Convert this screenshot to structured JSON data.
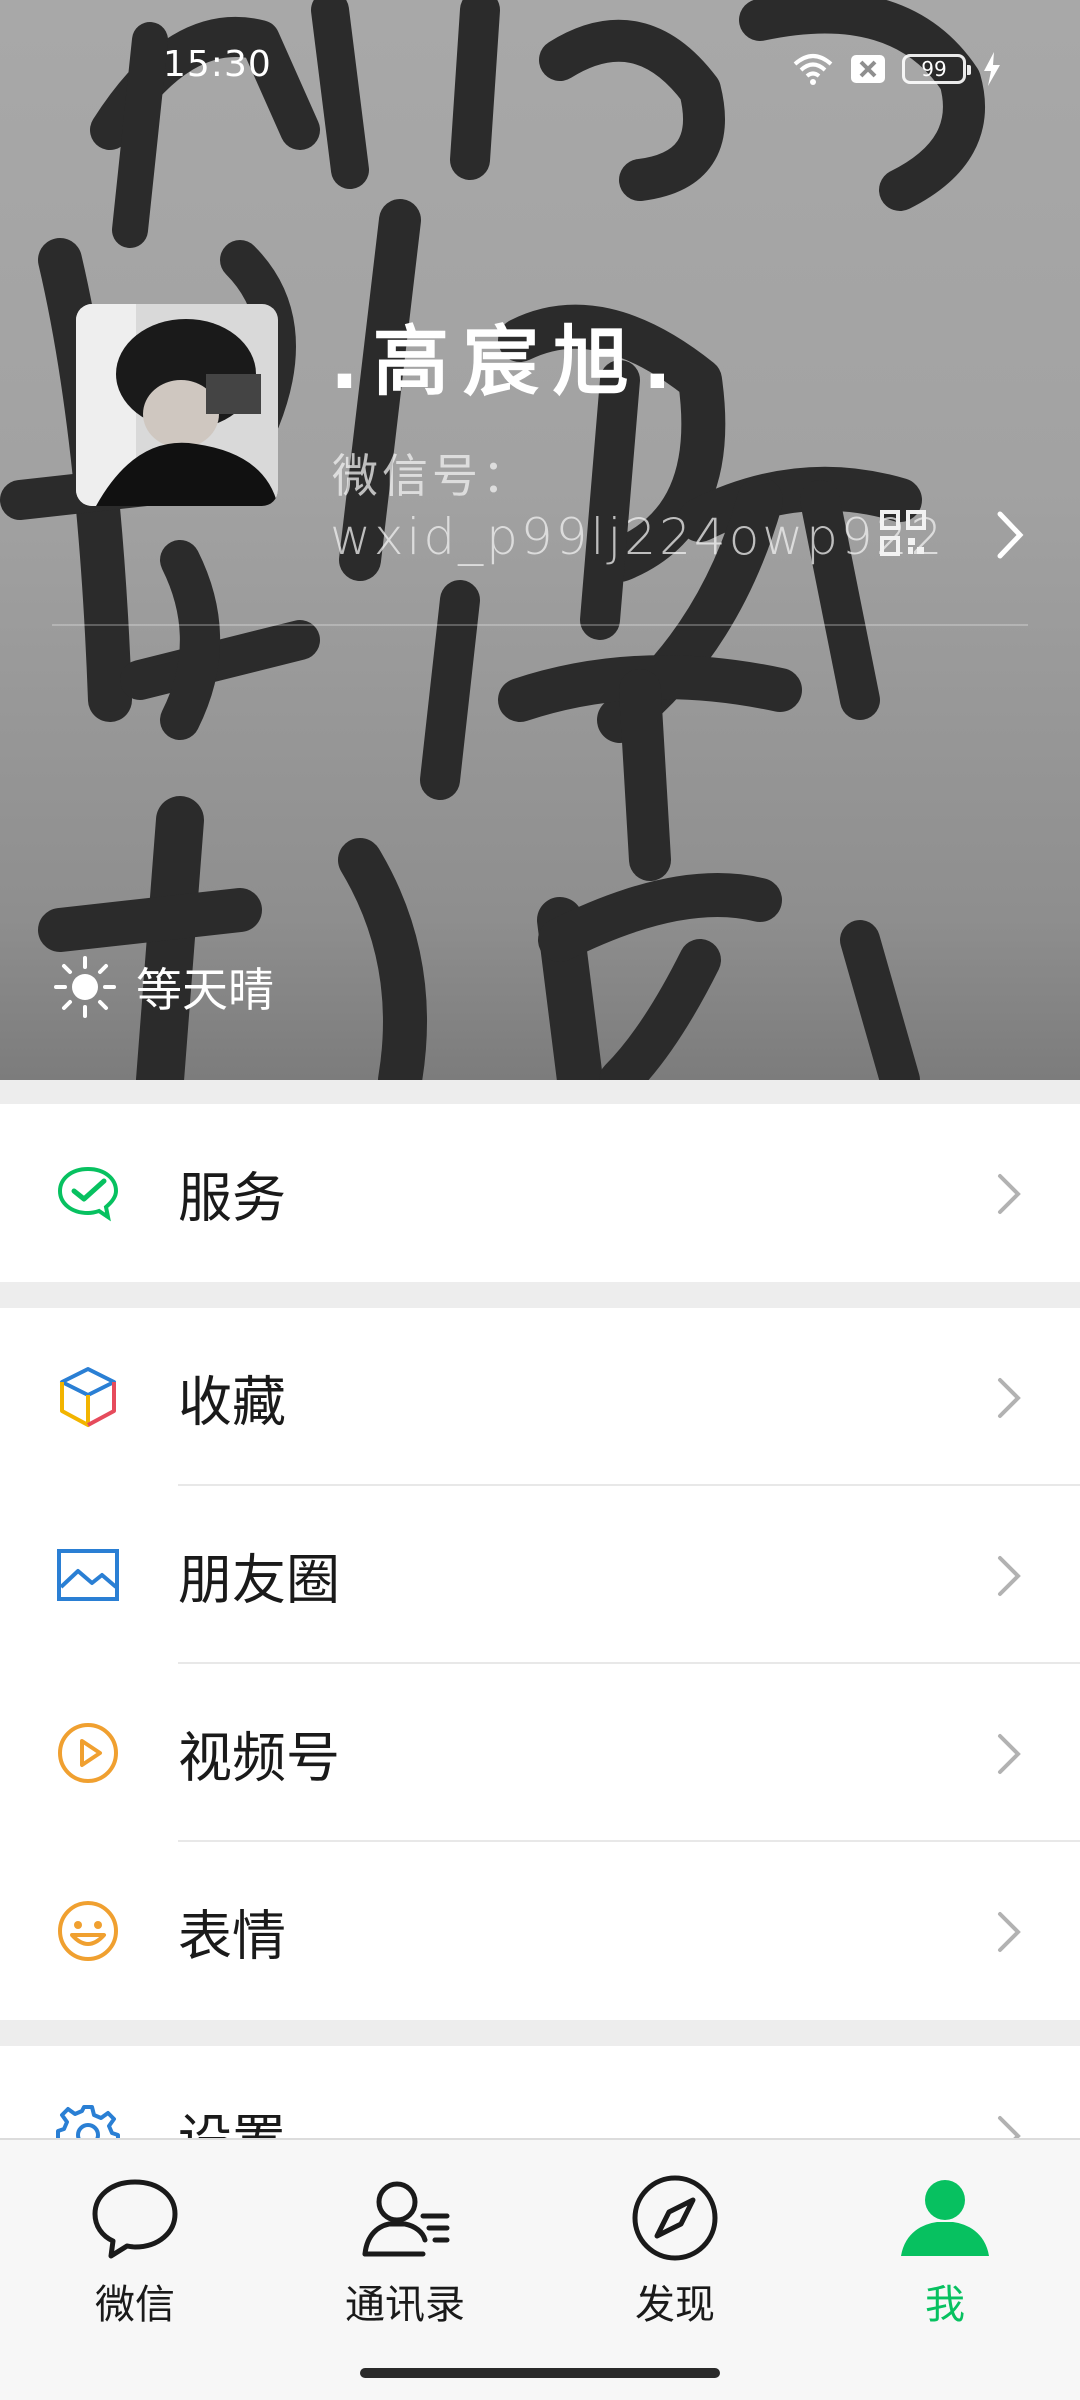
{
  "status_bar": {
    "time": "15:30",
    "battery": "99",
    "icons": [
      "wifi-icon",
      "sim-off-icon",
      "battery-icon",
      "charging-icon"
    ]
  },
  "profile": {
    "name": ".高宸旭.",
    "wechat_id_label": "微信号：",
    "wechat_id": "wxid_p99lj224owp922",
    "status": "等天晴",
    "status_icon": "sun-icon"
  },
  "menu": {
    "group1": [
      {
        "label": "服务",
        "icon": "service-icon",
        "color": "#07c160"
      }
    ],
    "group2": [
      {
        "label": "收藏",
        "icon": "favorites-cube-icon",
        "color": "#f2b400"
      },
      {
        "label": "朋友圈",
        "icon": "moments-image-icon",
        "color": "#2a7fd4"
      },
      {
        "label": "视频号",
        "icon": "channels-play-icon",
        "color": "#f0a030"
      },
      {
        "label": "表情",
        "icon": "sticker-smile-icon",
        "color": "#f0a030"
      }
    ],
    "group3": [
      {
        "label": "设置",
        "icon": "settings-gear-icon",
        "color": "#2a7fd4"
      }
    ]
  },
  "tabbar": {
    "tabs": [
      {
        "label": "微信",
        "icon": "chat-bubble-icon"
      },
      {
        "label": "通讯录",
        "icon": "contacts-icon"
      },
      {
        "label": "发现",
        "icon": "compass-icon"
      },
      {
        "label": "我",
        "icon": "person-icon",
        "active": true
      }
    ],
    "active_color": "#07c160"
  }
}
